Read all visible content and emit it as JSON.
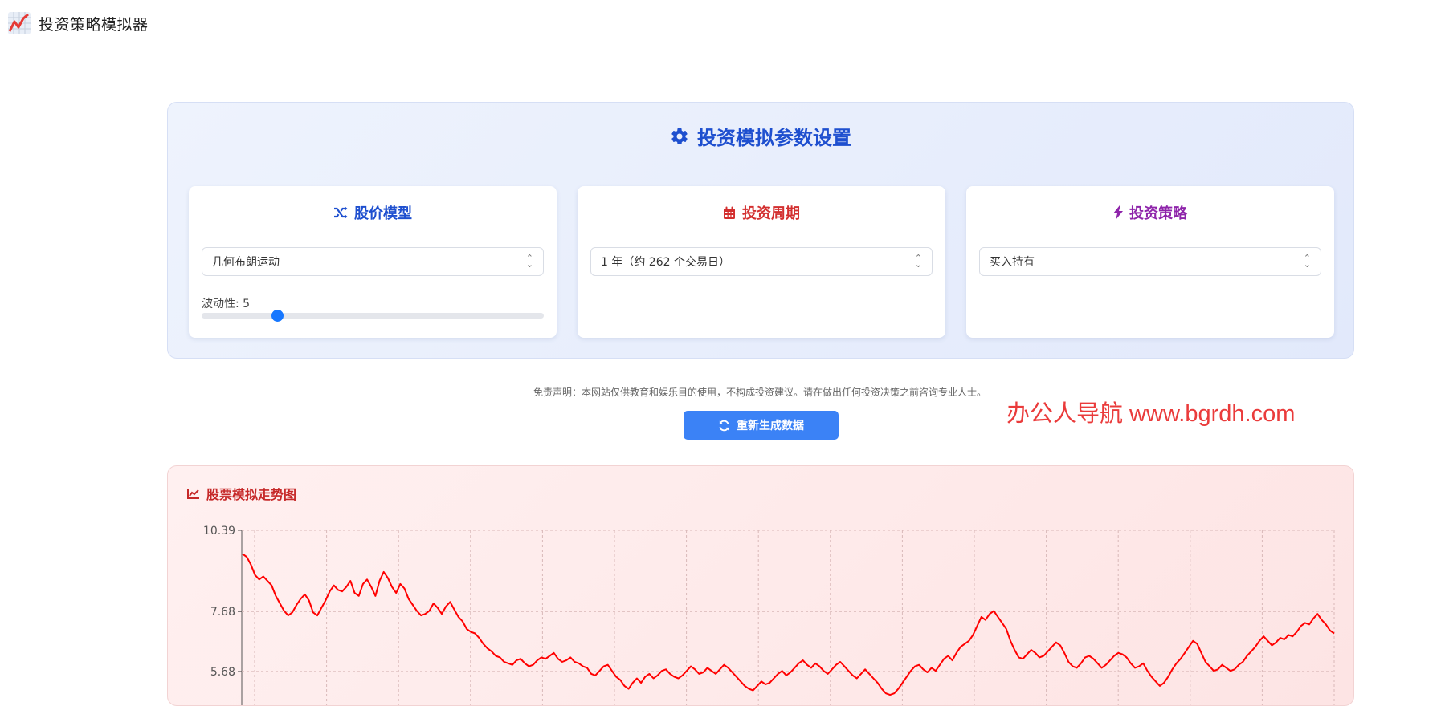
{
  "app": {
    "title": "投资策略模拟器",
    "icon": "chart-line-icon"
  },
  "settings": {
    "title": "投资模拟参数设置",
    "model": {
      "title": "股价模型",
      "selected": "几何布朗运动",
      "volatility_label": "波动性: 5",
      "volatility_fraction": 0.22,
      "color": "#1e4fcf"
    },
    "period": {
      "title": "投资周期",
      "selected": "1 年（约 262 个交易日）",
      "color": "#d32f2f"
    },
    "strategy": {
      "title": "投资策略",
      "selected": "买入持有",
      "color": "#8e24aa"
    }
  },
  "disclaimer": "免责声明：本网站仅供教育和娱乐目的使用，不构成投资建议。请在做出任何投资决策之前咨询专业人士。",
  "regenerate_label": "重新生成数据",
  "watermark": "办公人导航 www.bgrdh.com",
  "chart_panel_title": "股票模拟走势图",
  "colors": {
    "accent": "#3b82f6",
    "line": "#ff0000"
  },
  "chart_data": {
    "type": "line",
    "y_ticks": [
      "10.39",
      "7.68",
      "5.68"
    ],
    "ylim_visible": [
      4.5,
      10.39
    ],
    "grid": true,
    "x_count": 262,
    "values": [
      9.6,
      9.5,
      9.25,
      8.9,
      8.75,
      8.85,
      8.7,
      8.55,
      8.2,
      7.95,
      7.7,
      7.55,
      7.65,
      7.9,
      8.1,
      8.25,
      8.05,
      7.65,
      7.55,
      7.8,
      8.05,
      8.35,
      8.55,
      8.4,
      8.35,
      8.5,
      8.7,
      8.3,
      8.2,
      8.6,
      8.75,
      8.5,
      8.2,
      8.7,
      9.0,
      8.8,
      8.5,
      8.3,
      8.6,
      8.45,
      8.1,
      7.9,
      7.7,
      7.55,
      7.6,
      7.7,
      7.95,
      7.8,
      7.6,
      7.85,
      8.0,
      7.75,
      7.5,
      7.35,
      7.1,
      7.0,
      6.95,
      6.8,
      6.6,
      6.45,
      6.35,
      6.2,
      6.15,
      6.0,
      5.95,
      5.9,
      6.05,
      6.1,
      5.95,
      5.85,
      5.9,
      6.05,
      6.15,
      6.1,
      6.2,
      6.3,
      6.1,
      6.0,
      6.05,
      6.15,
      6.0,
      5.95,
      5.85,
      5.8,
      5.6,
      5.55,
      5.7,
      5.85,
      5.9,
      5.7,
      5.5,
      5.4,
      5.2,
      5.1,
      5.3,
      5.45,
      5.3,
      5.5,
      5.6,
      5.45,
      5.55,
      5.7,
      5.75,
      5.6,
      5.5,
      5.45,
      5.55,
      5.7,
      5.85,
      5.75,
      5.6,
      5.65,
      5.8,
      5.7,
      5.6,
      5.75,
      5.9,
      5.8,
      5.65,
      5.5,
      5.35,
      5.2,
      5.1,
      5.05,
      5.2,
      5.35,
      5.25,
      5.3,
      5.45,
      5.6,
      5.7,
      5.55,
      5.65,
      5.8,
      5.95,
      6.05,
      5.9,
      5.8,
      5.95,
      5.85,
      5.7,
      5.6,
      5.75,
      5.9,
      6.0,
      5.85,
      5.7,
      5.55,
      5.45,
      5.6,
      5.75,
      5.6,
      5.45,
      5.3,
      5.1,
      4.95,
      4.9,
      4.95,
      5.1,
      5.3,
      5.5,
      5.7,
      5.85,
      5.9,
      5.75,
      5.65,
      5.8,
      5.7,
      5.9,
      6.1,
      6.2,
      6.05,
      6.3,
      6.5,
      6.6,
      6.7,
      6.9,
      7.2,
      7.5,
      7.4,
      7.6,
      7.7,
      7.5,
      7.3,
      7.1,
      6.7,
      6.4,
      6.15,
      6.1,
      6.25,
      6.4,
      6.3,
      6.15,
      6.2,
      6.35,
      6.5,
      6.65,
      6.55,
      6.3,
      6.0,
      5.85,
      5.8,
      5.95,
      6.15,
      6.2,
      6.1,
      5.95,
      5.8,
      5.9,
      6.05,
      6.2,
      6.3,
      6.25,
      6.15,
      5.95,
      5.8,
      5.85,
      5.95,
      5.7,
      5.5,
      5.35,
      5.2,
      5.3,
      5.5,
      5.75,
      5.95,
      6.1,
      6.3,
      6.5,
      6.7,
      6.6,
      6.3,
      6.0,
      5.85,
      5.7,
      5.75,
      5.9,
      5.8,
      5.7,
      5.75,
      5.9,
      6.0,
      6.2,
      6.35,
      6.5,
      6.7,
      6.85,
      6.7,
      6.55,
      6.65,
      6.8,
      6.75,
      6.9,
      6.85,
      7.0,
      7.2,
      7.3,
      7.25,
      7.45,
      7.6,
      7.4,
      7.25,
      7.05,
      6.95
    ]
  }
}
